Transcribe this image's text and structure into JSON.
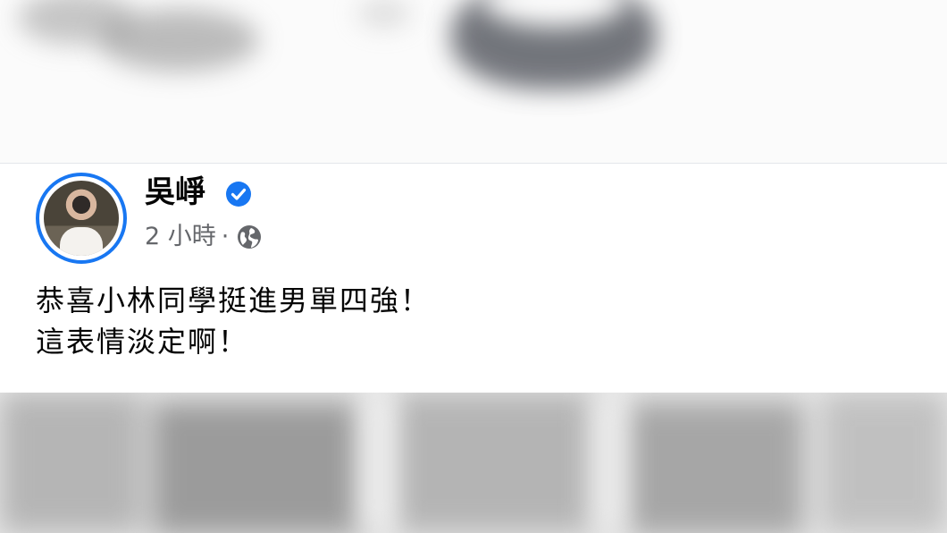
{
  "post": {
    "author_name": "吳崢",
    "verified": true,
    "timestamp": "2 小時",
    "separator": "·",
    "privacy_icon": "globe-icon",
    "text_lines": [
      "恭喜小林同學挺進男單四強！",
      "這表情淡定啊！"
    ]
  },
  "colors": {
    "accent": "#1877f2",
    "meta_text": "#65676b",
    "body_text": "#050505"
  }
}
